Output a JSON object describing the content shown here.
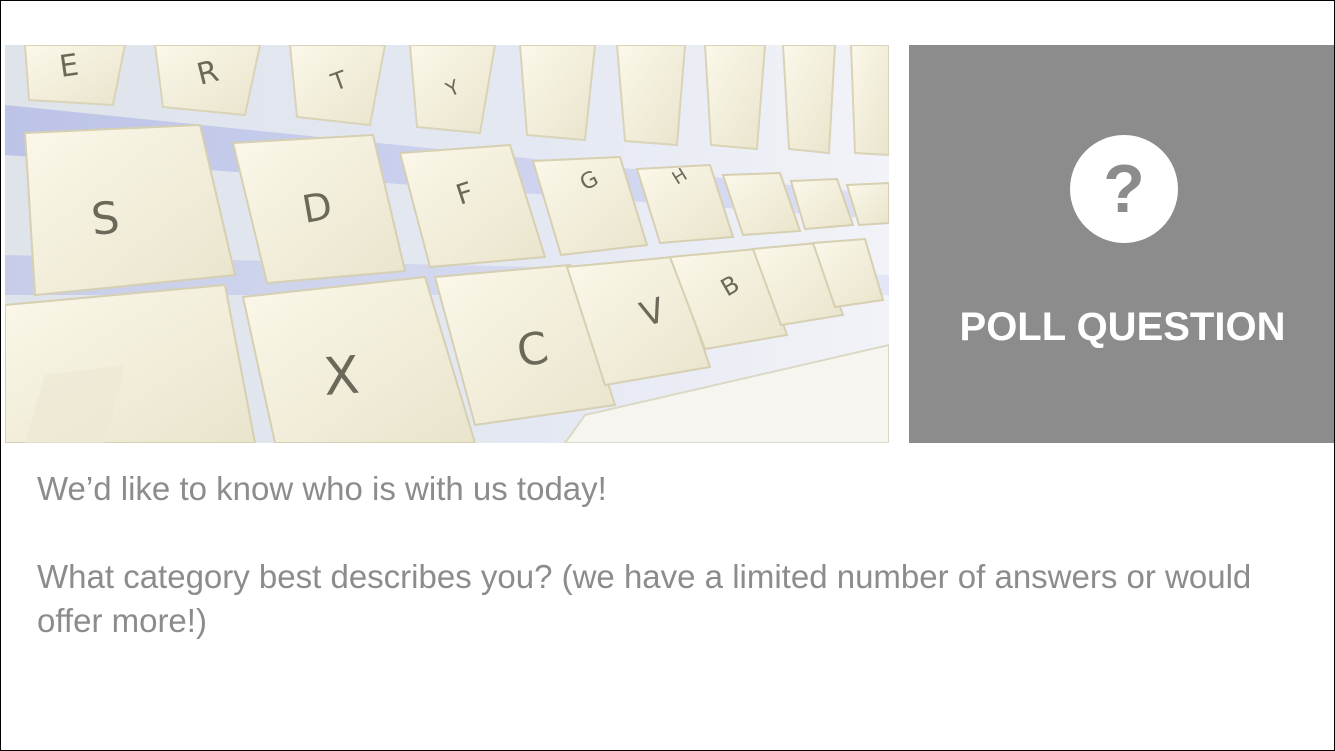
{
  "slide": {
    "poll_label": "POLL QUESTION",
    "question_glyph": "?",
    "intro": "We’d like to know who is with us today!",
    "question": "What category best describes you?  (we have a limited number of answers or would offer more!)"
  },
  "image": {
    "subject": "keyboard-photo",
    "keys": [
      "E",
      "R",
      "T",
      "Y",
      "S",
      "D",
      "F",
      "G",
      "H",
      "X",
      "C",
      "V",
      "B"
    ]
  },
  "colors": {
    "panel": "#8c8c8c",
    "panel_text": "#ffffff",
    "body_text": "#8c8c8c",
    "border": "#000000"
  }
}
